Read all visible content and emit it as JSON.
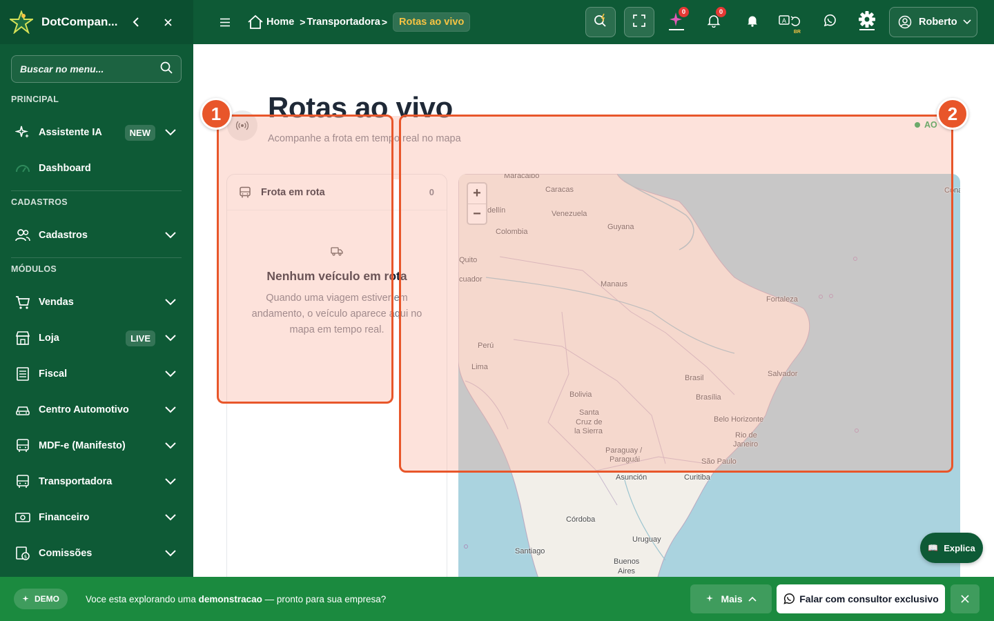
{
  "app": {
    "name": "DotCompan..."
  },
  "sidebar": {
    "search_placeholder": "Buscar no menu...",
    "sections": {
      "principal": "PRINCIPAL",
      "cadastros": "CADASTROS",
      "modulos": "MÓDULOS"
    },
    "items": [
      {
        "label": "Assistente IA",
        "badge": "NEW",
        "icon": "sparkles-icon"
      },
      {
        "label": "Dashboard",
        "badge": "",
        "icon": "gauge-icon"
      },
      {
        "label": "Cadastros",
        "badge": "",
        "icon": "users-icon"
      },
      {
        "label": "Vendas",
        "badge": "",
        "icon": "cart-icon"
      },
      {
        "label": "Loja",
        "badge": "LIVE",
        "icon": "store-icon"
      },
      {
        "label": "Fiscal",
        "badge": "",
        "icon": "receipt-icon"
      },
      {
        "label": "Centro Automotivo",
        "badge": "",
        "icon": "car-icon"
      },
      {
        "label": "MDF-e (Manifesto)",
        "badge": "",
        "icon": "bus-icon"
      },
      {
        "label": "Transportadora",
        "badge": "",
        "icon": "bus-icon"
      },
      {
        "label": "Financeiro",
        "badge": "",
        "icon": "banknote-icon"
      },
      {
        "label": "Comissões",
        "badge": "",
        "icon": "commission-icon"
      }
    ]
  },
  "topbar": {
    "breadcrumbs": [
      "Home",
      "Transportadora",
      "Rotas ao vivo"
    ],
    "ai_badge": "0",
    "notif_badge": "0",
    "lang_code": "BR",
    "user_name": "Roberto"
  },
  "page": {
    "title": "Rotas ao vivo",
    "subtitle": "Acompanhe a frota em tempo real no mapa",
    "live_label": "AO"
  },
  "fleet": {
    "title": "Frota em rota",
    "count": "0",
    "empty_title": "Nenhum veículo em rota",
    "empty_desc": "Quando uma viagem estiver em andamento, o veículo aparece aqui no mapa em tempo real."
  },
  "map": {
    "zoom_in": "+",
    "zoom_out": "−",
    "labels": {
      "maracaibo": "Maracaibo",
      "caracas": "Caracas",
      "medellin": "dellín",
      "venezuela": "Venezuela",
      "guyana": "Guyana",
      "colombia": "Colombia",
      "quito": "Quito",
      "ecuador": "cuador",
      "manaus": "Manaus",
      "fortaleza": "Fortaleza",
      "peru": "Perú",
      "lima": "Lima",
      "brasil": "Brasil",
      "salvador": "Salvador",
      "bolivia": "Bolivia",
      "brasilia": "Brasília",
      "santacruz1": "Santa",
      "santacruz2": "Cruz de",
      "santacruz3": "la Sierra",
      "belo": "Belo Horizonte",
      "rio1": "Rio de",
      "rio2": "Janeiro",
      "paraguay1": "Paraguay /",
      "paraguay2": "Paraguái",
      "saopaulo": "São Paulo",
      "asuncion": "Asunción",
      "curitiba": "Curitiba",
      "cordoba": "Córdoba",
      "uruguay": "Uruguay",
      "santiago": "Santiago",
      "buenos1": "Buenos",
      "buenos2": "Aires",
      "edge": "Cona"
    }
  },
  "annotations": [
    "1",
    "2"
  ],
  "explica": {
    "label": "Explica"
  },
  "demo_bar": {
    "badge": "DEMO",
    "text_a": "Voce esta explorando uma ",
    "text_b": "demonstracao",
    "text_c": " — pronto para sua empresa?",
    "more_label": "Mais",
    "cta_label": "Falar com consultor exclusivo"
  },
  "colors": {
    "brand": "#0e5a36",
    "accent": "#f6c343",
    "annotation": "#e8562a",
    "demo": "#1b8a3f"
  }
}
